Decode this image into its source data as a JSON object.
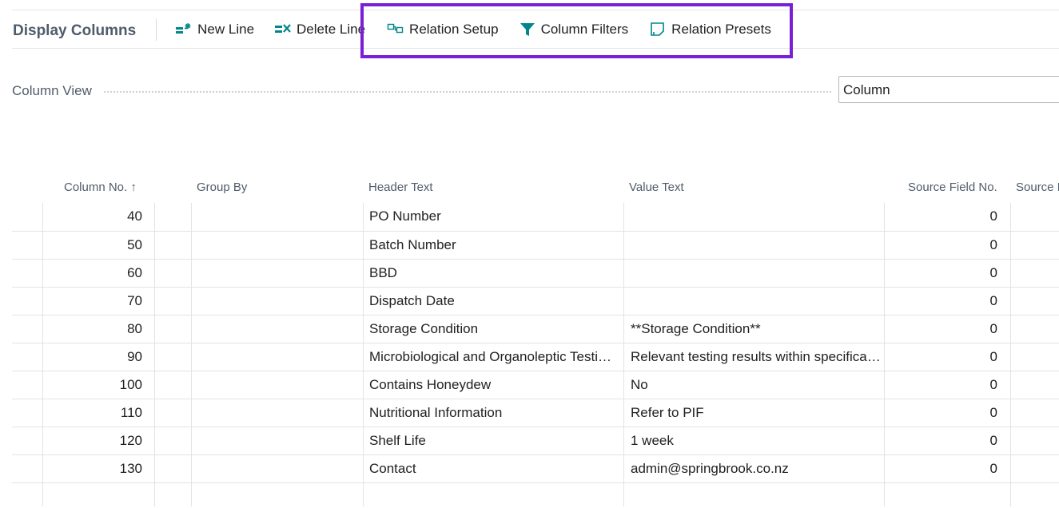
{
  "page": {
    "title": "Display Columns"
  },
  "actions": [
    {
      "label": "New Line",
      "icon": "new-line-icon"
    },
    {
      "label": "Delete Line",
      "icon": "delete-line-icon"
    },
    {
      "label": "Relation Setup",
      "icon": "relation-setup-icon"
    },
    {
      "label": "Column Filters",
      "icon": "filter-icon"
    },
    {
      "label": "Relation Presets",
      "icon": "relation-presets-icon"
    }
  ],
  "field": {
    "label": "Column View",
    "value": "Column"
  },
  "grid": {
    "headers": {
      "column_no": "Column No.",
      "sort_indicator": "↑",
      "group_by": "Group By",
      "header_text": "Header Text",
      "value_text": "Value Text",
      "source_field_no": "Source Field No.",
      "source_f": "Source F"
    },
    "rows": [
      {
        "column_no": "40",
        "group_by": false,
        "header_text": "PO Number",
        "value_text": "",
        "source_field_no": "0"
      },
      {
        "column_no": "50",
        "group_by": false,
        "header_text": "Batch Number",
        "value_text": "",
        "source_field_no": "0"
      },
      {
        "column_no": "60",
        "group_by": false,
        "header_text": "BBD",
        "value_text": "",
        "source_field_no": "0"
      },
      {
        "column_no": "70",
        "group_by": false,
        "header_text": "Dispatch Date",
        "value_text": "",
        "source_field_no": "0"
      },
      {
        "column_no": "80",
        "group_by": false,
        "header_text": "Storage Condition",
        "value_text": "**Storage Condition**",
        "source_field_no": "0"
      },
      {
        "column_no": "90",
        "group_by": false,
        "header_text": "Microbiological and Organoleptic Testi…",
        "value_text": "Relevant testing results within specifica…",
        "source_field_no": "0"
      },
      {
        "column_no": "100",
        "group_by": false,
        "header_text": "Contains Honeydew",
        "value_text": "No",
        "source_field_no": "0"
      },
      {
        "column_no": "110",
        "group_by": false,
        "header_text": "Nutritional Information",
        "value_text": "Refer to PIF",
        "source_field_no": "0"
      },
      {
        "column_no": "120",
        "group_by": false,
        "header_text": "Shelf Life",
        "value_text": "1 week",
        "source_field_no": "0"
      },
      {
        "column_no": "130",
        "group_by": false,
        "header_text": "Contact",
        "value_text": "admin@springbrook.co.nz",
        "source_field_no": "0"
      },
      {
        "column_no": "",
        "group_by": null,
        "header_text": "",
        "value_text": "",
        "source_field_no": ""
      }
    ]
  },
  "colors": {
    "accent": "#00868b",
    "highlight": "#7a1fd6",
    "caption": "#505c6b"
  }
}
